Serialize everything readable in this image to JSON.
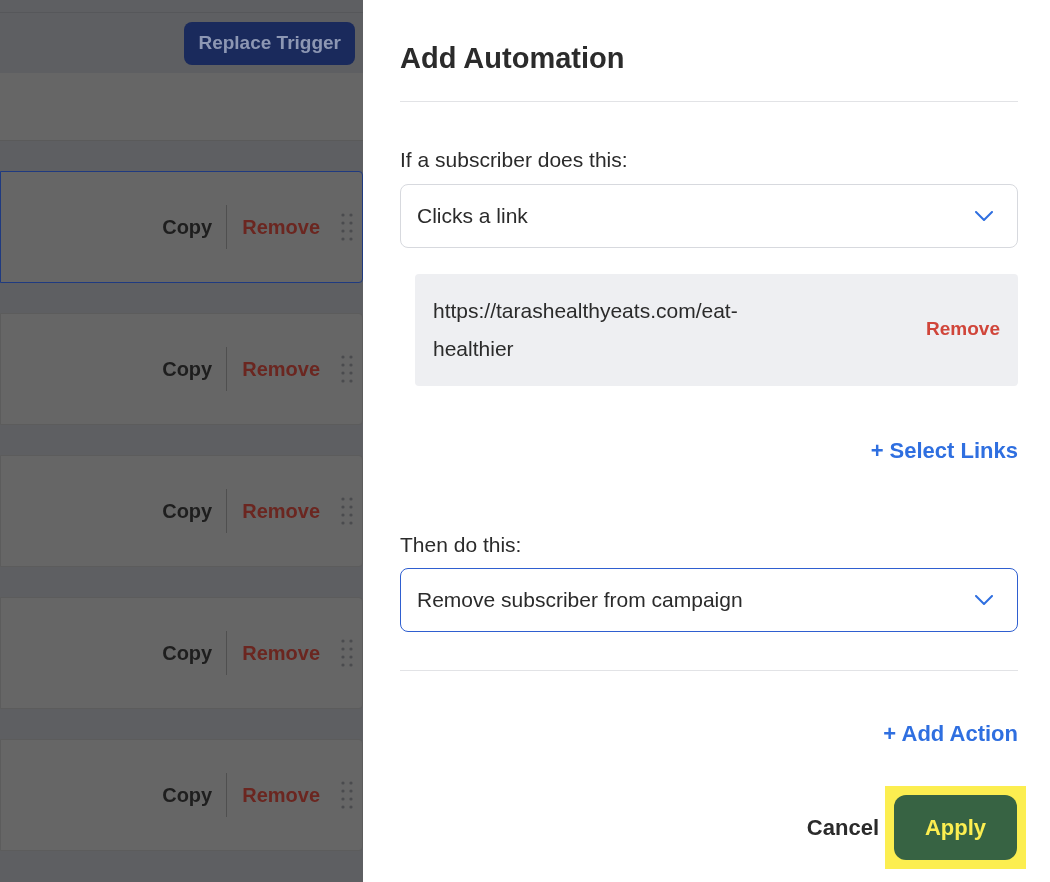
{
  "background": {
    "replace_trigger_button": "Replace Trigger",
    "cards": [
      {
        "selected": true,
        "copy": "Copy",
        "remove": "Remove"
      },
      {
        "selected": false,
        "copy": "Copy",
        "remove": "Remove"
      },
      {
        "selected": false,
        "copy": "Copy",
        "remove": "Remove"
      },
      {
        "selected": false,
        "copy": "Copy",
        "remove": "Remove"
      },
      {
        "selected": false,
        "copy": "Copy",
        "remove": "Remove"
      }
    ]
  },
  "panel": {
    "title": "Add Automation",
    "trigger": {
      "label": "If a subscriber does this:",
      "value": "Clicks a link",
      "focused": false
    },
    "links": [
      {
        "url": "https://tarashealthyeats.com/eat-healthier",
        "remove": "Remove"
      }
    ],
    "select_links": "+ Select Links",
    "action": {
      "label": "Then do this:",
      "value": "Remove subscriber from campaign",
      "focused": true
    },
    "add_action": "+ Add Action",
    "cancel": "Cancel",
    "apply": {
      "label": "Apply",
      "highlighted": true
    }
  }
}
